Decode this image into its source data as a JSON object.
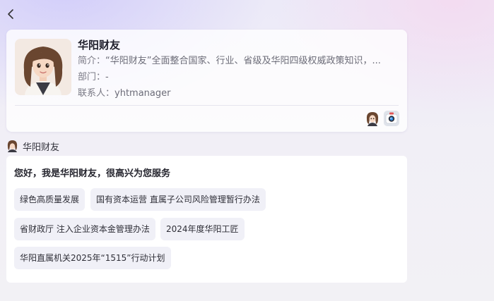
{
  "nav": {
    "back_icon": "chevron-left-icon"
  },
  "profile": {
    "name": "华阳财友",
    "intro_label": "简介：",
    "intro_value": "“华阳财友”全面整合国家、行业、省级及华阳四级权威政策知识，...",
    "dept_label": "部门：",
    "dept_value": "-",
    "contact_label": "联系人：",
    "contact_value": "yhtmanager",
    "avatar_icon": "assistant-avatar-icon",
    "mini_icons": [
      "assistant-avatar-icon",
      "camera-icon"
    ]
  },
  "message": {
    "sender_name": "华阳财友",
    "greeting": "您好，我是华阳财友，很高兴为您服务",
    "suggestions": [
      "绿色高质量发展",
      "国有资本运营 直属子公司风险管理暂行办法",
      "省财政厅 注入企业资本金管理办法",
      "2024年度华阳工匠",
      "华阳直属机关2025年“1515”行动计划"
    ]
  },
  "colors": {
    "accent": "#7b72e6",
    "chip_bg": "#f0f0f7",
    "card_bg": "#ffffff"
  }
}
